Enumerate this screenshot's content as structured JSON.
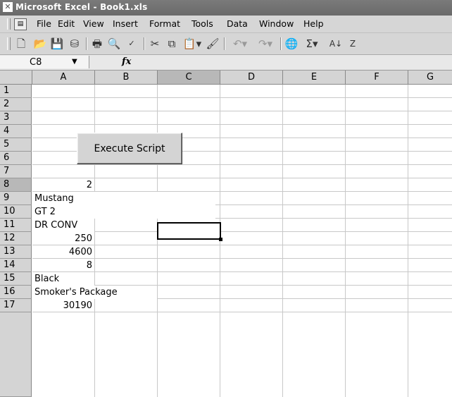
{
  "window": {
    "title": "Microsoft Excel - Book1.xls"
  },
  "menu": [
    "File",
    "Edit",
    "View",
    "Insert",
    "Format",
    "Tools",
    "Data",
    "Window",
    "Help"
  ],
  "toolbar_icons": [
    "new-icon",
    "open-icon",
    "save-icon",
    "permission-icon",
    "print-icon",
    "print-preview-icon",
    "spelling-icon",
    "cut-icon",
    "copy-icon",
    "paste-icon",
    "format-painter-icon",
    "undo-icon",
    "redo-icon",
    "hyperlink-icon",
    "autosum-icon",
    "sort-ascending-icon",
    "sort-descending-icon"
  ],
  "namebox": {
    "value": "C8"
  },
  "formula": {
    "fx": "fx",
    "value": ""
  },
  "columns": [
    "A",
    "B",
    "C",
    "D",
    "E",
    "F",
    "G"
  ],
  "rows": [
    "1",
    "2",
    "3",
    "4",
    "5",
    "6",
    "7",
    "8",
    "9",
    "10",
    "11",
    "12",
    "13",
    "14",
    "15",
    "16",
    "17"
  ],
  "cells": {
    "A8": "2",
    "A9": "Mustang",
    "A10": "GT 2",
    "A11": "DR CONV",
    "A12": "250",
    "A13": "4600",
    "A14": "8",
    "A15": "Black",
    "A16": "Smoker's Package",
    "A17": "30190"
  },
  "button": {
    "label": "Execute Script"
  },
  "selection": {
    "cell": "C8"
  }
}
